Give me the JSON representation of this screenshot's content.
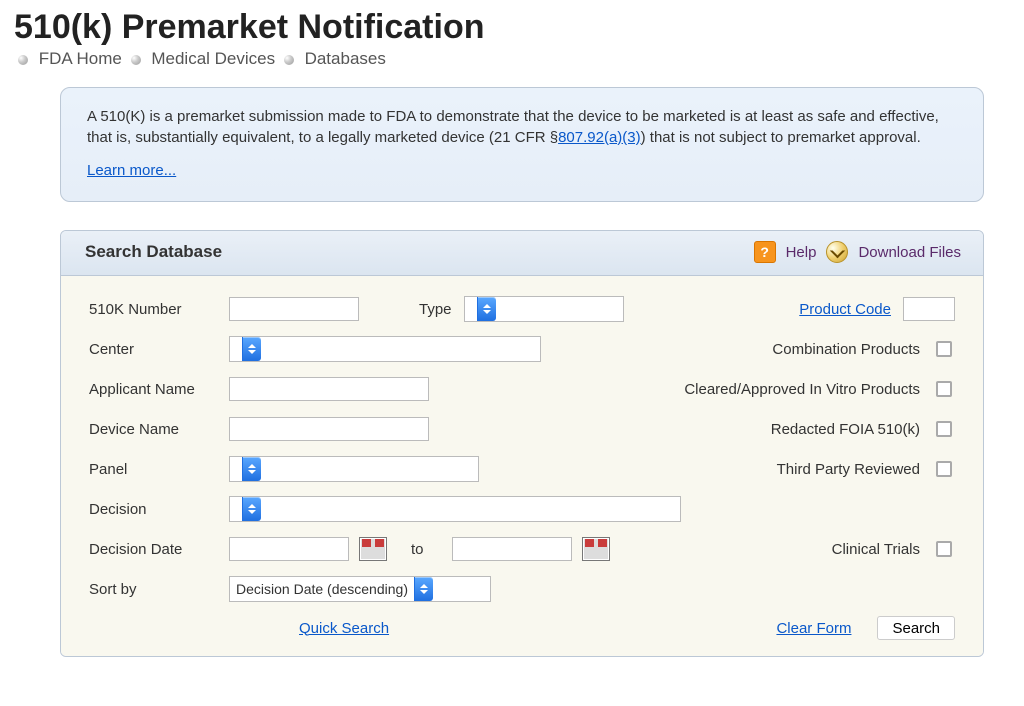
{
  "title": "510(k) Premarket Notification",
  "breadcrumb": {
    "items": [
      "FDA Home",
      "Medical Devices",
      "Databases"
    ]
  },
  "info": {
    "text_before": "A 510(K) is a premarket submission made to FDA to demonstrate that the device to be marketed is at least as safe and effective, that is, substantially equivalent, to a legally marketed device (21 CFR §",
    "cfr_link": "807.92(a)(3)",
    "text_after": ") that is not subject to premarket approval.",
    "learn_more": "Learn more..."
  },
  "search": {
    "header_title": "Search Database",
    "help_label": "Help",
    "download_label": "Download Files",
    "labels": {
      "number": "510K Number",
      "type": "Type",
      "product_code": "Product Code",
      "center": "Center",
      "combination": "Combination Products",
      "applicant": "Applicant Name",
      "cleared_vitro": "Cleared/Approved In Vitro Products",
      "device_name": "Device Name",
      "redacted": "Redacted FOIA 510(k)",
      "panel": "Panel",
      "third_party": "Third Party Reviewed",
      "decision": "Decision",
      "decision_date": "Decision Date",
      "to": "to",
      "clinical": "Clinical Trials",
      "sort_by": "Sort by"
    },
    "values": {
      "number": "",
      "type": "",
      "product_code": "",
      "center": "",
      "applicant": "",
      "device_name": "",
      "panel": "",
      "decision": "",
      "date_from": "",
      "date_to": "",
      "sort_by": "Decision Date (descending)"
    },
    "actions": {
      "quick_search": "Quick Search",
      "clear_form": "Clear Form",
      "search": "Search"
    }
  }
}
